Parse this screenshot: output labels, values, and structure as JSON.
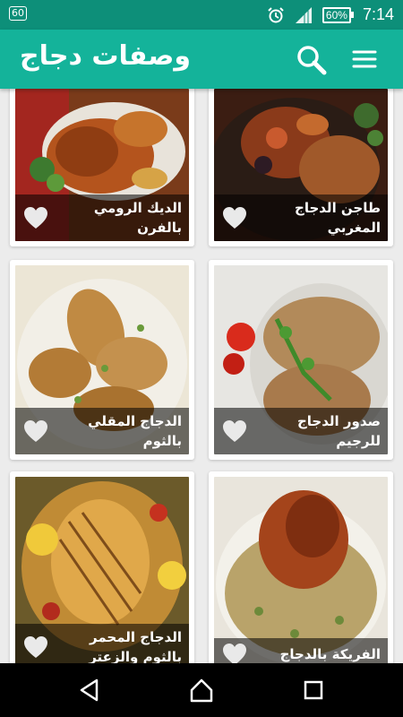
{
  "status_bar": {
    "notification_badge": "60",
    "battery_percent": "60%",
    "time": "7:14",
    "icons": [
      "alarm-icon",
      "signal-icon",
      "battery-icon"
    ]
  },
  "app_bar": {
    "title": "وصفات دجاج",
    "icons": [
      "search-icon",
      "menu-icon"
    ],
    "color": "#14b39a"
  },
  "recipes": [
    {
      "title": "الديك الرومي بالفرن",
      "favorite": false
    },
    {
      "title": "طاجن الدجاج المغربي",
      "favorite": false
    },
    {
      "title": "الدجاج المقلي بالثوم",
      "favorite": false
    },
    {
      "title": "صدور الدجاج للرجيم",
      "favorite": false
    },
    {
      "title": "الدجاج المحمر بالثوم والزعتر",
      "favorite": false
    },
    {
      "title": "الفريكة بالدجاج",
      "favorite": false
    }
  ],
  "nav_bar": {
    "icons": [
      "back-icon",
      "home-icon",
      "recents-icon"
    ]
  }
}
